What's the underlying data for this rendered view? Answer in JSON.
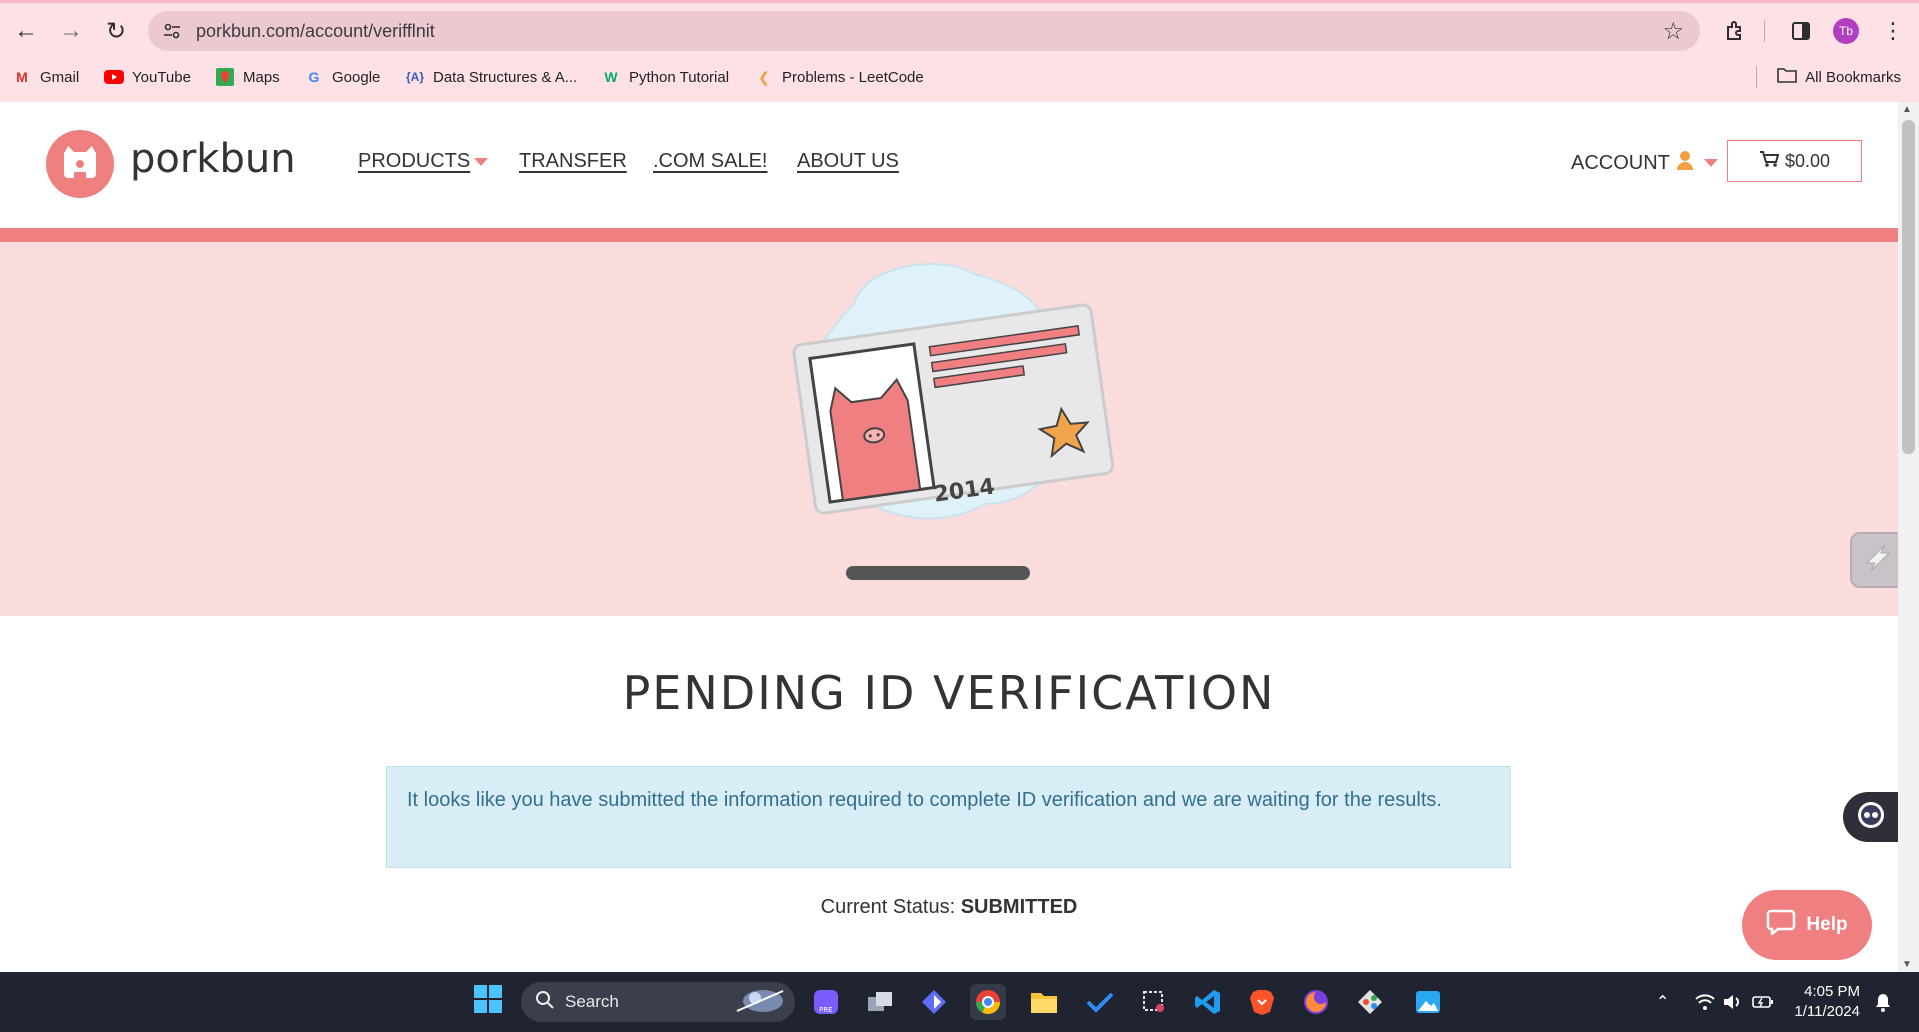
{
  "browser": {
    "url": "porkbun.com/account/verifflnit",
    "profile_initials": "Tb",
    "bookmarks": [
      {
        "label": "Gmail",
        "icon": "gmail-icon"
      },
      {
        "label": "YouTube",
        "icon": "youtube-icon"
      },
      {
        "label": "Maps",
        "icon": "maps-icon"
      },
      {
        "label": "Google",
        "icon": "google-icon"
      },
      {
        "label": "Data Structures & A...",
        "icon": "ds-icon"
      },
      {
        "label": "Python Tutorial",
        "icon": "w3-icon"
      },
      {
        "label": "Problems - LeetCode",
        "icon": "leetcode-icon"
      }
    ],
    "all_bookmarks_label": "All Bookmarks"
  },
  "site": {
    "logo_text": "porkbun",
    "nav": {
      "products": "PRODUCTS",
      "transfer": "TRANSFER",
      "com_sale": ".COM SALE!",
      "about": "ABOUT US"
    },
    "account_label": "ACCOUNT",
    "cart_total": "$0.00",
    "hero_card_year": "2014",
    "page_title": "PENDING ID VERIFICATION",
    "alert_text": "It looks like you have submitted the information required to complete ID verification and we are waiting for the results.",
    "status_label": "Current Status:",
    "status_value": "SUBMITTED",
    "help_label": "Help",
    "colors": {
      "brand": "#f07f81",
      "hero_bg": "#fadcdc",
      "alert_bg": "#d9edf7",
      "alert_text": "#31708f"
    }
  },
  "taskbar": {
    "search_placeholder": "Search",
    "time": "4:05 PM",
    "date": "1/11/2024"
  }
}
